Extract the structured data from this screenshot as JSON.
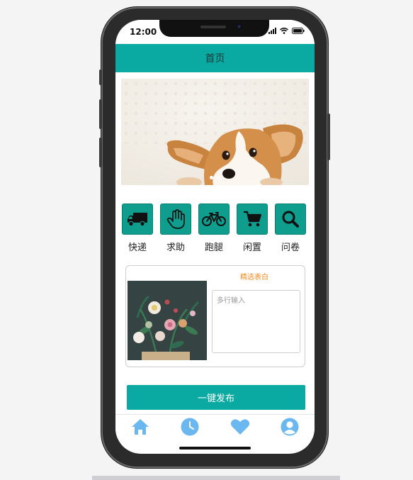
{
  "status_bar": {
    "time": "12:00"
  },
  "header": {
    "title": "首页"
  },
  "banner": {
    "slide_count": 2,
    "active_slide": 1
  },
  "categories": [
    {
      "label": "快递",
      "icon": "truck-icon"
    },
    {
      "label": "求助",
      "icon": "hand-icon"
    },
    {
      "label": "跑腿",
      "icon": "bicycle-icon"
    },
    {
      "label": "闲置",
      "icon": "cart-icon"
    },
    {
      "label": "问卷",
      "icon": "search-icon"
    }
  ],
  "card": {
    "title": "精选表白",
    "textarea_placeholder": "多行输入",
    "textarea_value": ""
  },
  "publish_button": {
    "label": "一键发布"
  },
  "tab_bar": [
    {
      "icon": "home-icon"
    },
    {
      "icon": "clock-icon"
    },
    {
      "icon": "heart-icon"
    },
    {
      "icon": "user-icon"
    }
  ],
  "colors": {
    "primary": "#0aa9a2",
    "category_tile": "#0f9d8e",
    "card_title": "#f08a1c",
    "tab_icon": "#6bb7ef"
  }
}
